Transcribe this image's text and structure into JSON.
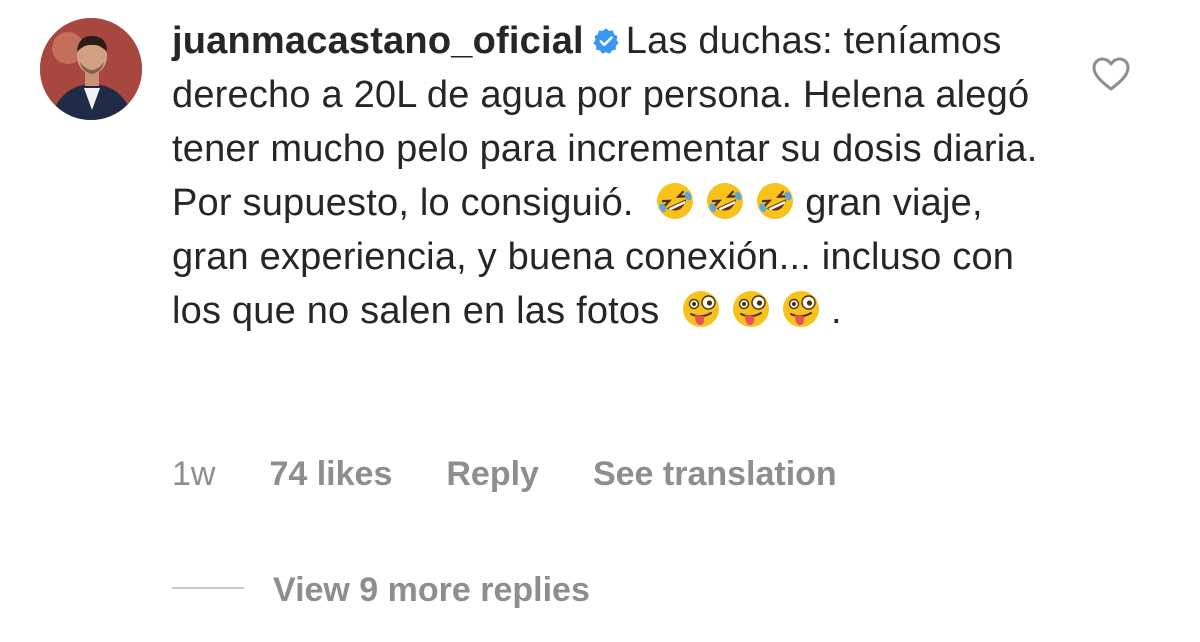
{
  "comment": {
    "username": "juanmacastano_oficial",
    "verified": true,
    "text_part1": "Las duchas: teníamos derecho a 20L de agua por persona. Helena alegó tener mucho pelo para incrementar su dosis diaria. Por supuesto, lo consiguió.",
    "emoji_group1": [
      "rolling-on-floor-laughing",
      "rolling-on-floor-laughing",
      "rolling-on-floor-laughing"
    ],
    "text_part2": "gran viaje, gran experiencia, y buena conexión... incluso con los que no salen en las fotos",
    "emoji_group2": [
      "zany-face",
      "zany-face",
      "zany-face"
    ],
    "text_end": ".",
    "meta": {
      "time": "1w",
      "likes": "74 likes",
      "reply": "Reply",
      "translation": "See translation"
    },
    "view_replies": "View 9 more replies"
  },
  "icons": {
    "verified_color": "#3897f0",
    "heart": "heart-outline-icon"
  },
  "colors": {
    "text": "#262626",
    "muted": "#8e8e8e",
    "divider": "#c7c7c7"
  }
}
